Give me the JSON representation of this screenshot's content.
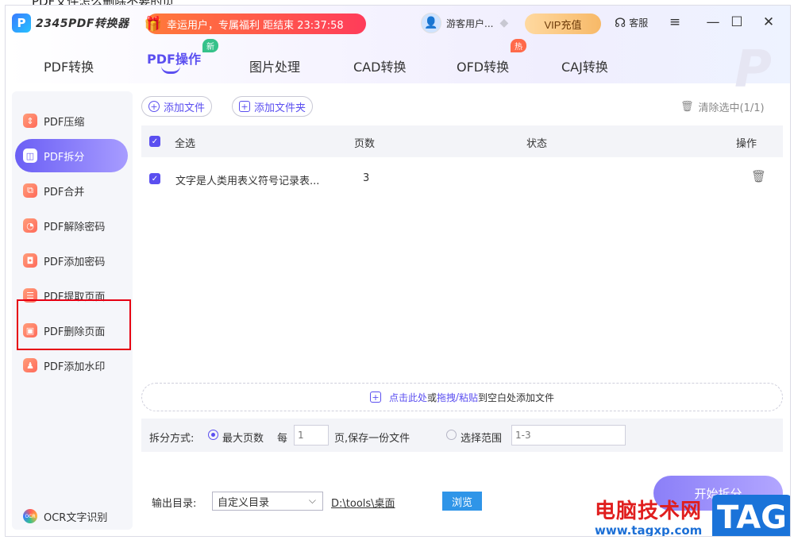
{
  "top_caption": "PDF文件怎么删除不要的页",
  "app": {
    "logo_letter": "P",
    "logo_text": "2345PDF转换器",
    "promo_text": "幸运用户，专属福利 距结束 23:37:58",
    "user_name": "游客用户...",
    "vip_label": "VIP充值",
    "service_label": "客服",
    "menu_icon": "≡",
    "minimize_icon": "—",
    "maximize_icon": "☐",
    "close_icon": "✕"
  },
  "nav": {
    "tabs": [
      {
        "label": "PDF转换"
      },
      {
        "label": "PDF操作"
      },
      {
        "label": "图片处理"
      },
      {
        "label": "CAD转换"
      },
      {
        "label": "OFD转换"
      },
      {
        "label": "CAJ转换"
      }
    ],
    "new_badge": "新",
    "hot_badge": "热",
    "active_color": "#5b4ff0"
  },
  "sidebar": {
    "items": [
      {
        "label": "PDF压缩",
        "icon": "compress-icon"
      },
      {
        "label": "PDF拆分",
        "icon": "split-icon"
      },
      {
        "label": "PDF合并",
        "icon": "merge-icon"
      },
      {
        "label": "PDF解除密码",
        "icon": "unlock-icon"
      },
      {
        "label": "PDF添加密码",
        "icon": "lock-icon"
      },
      {
        "label": "PDF提取页面",
        "icon": "extract-icon"
      },
      {
        "label": "PDF删除页面",
        "icon": "delete-page-icon"
      },
      {
        "label": "PDF添加水印",
        "icon": "watermark-icon"
      }
    ],
    "ocr_label": "OCR文字识别",
    "ocr_badge": "OCR"
  },
  "toolbar": {
    "add_file": "添加文件",
    "add_folder": "添加文件夹",
    "clear_selected": "清除选中(1/1)"
  },
  "table": {
    "headers": {
      "select_all": "全选",
      "pages": "页数",
      "status": "状态",
      "action": "操作"
    },
    "rows": [
      {
        "name": "文字是人类用表义符号记录表...",
        "pages": "3",
        "status": ""
      }
    ]
  },
  "drop_zone": {
    "click_here": "点击此处",
    "or": "或",
    "drag": "拖拽",
    "slash": "/",
    "paste": "粘贴",
    "rest": "到空白处添加文件"
  },
  "split": {
    "label": "拆分方式:",
    "option_max_pages": "最大页数",
    "every": "每",
    "every_value_placeholder": "1",
    "per_file": "页,保存一份文件",
    "option_range": "选择范围",
    "range_placeholder": "1-3"
  },
  "output": {
    "label": "输出目录:",
    "select_value": "自定义目录",
    "path": "D:\\tools\\桌面",
    "browse": "浏览",
    "start": "开始拆分"
  },
  "watermark": {
    "cn": "电脑技术网",
    "url": "www.tagxp.com",
    "tag": "TAG"
  }
}
